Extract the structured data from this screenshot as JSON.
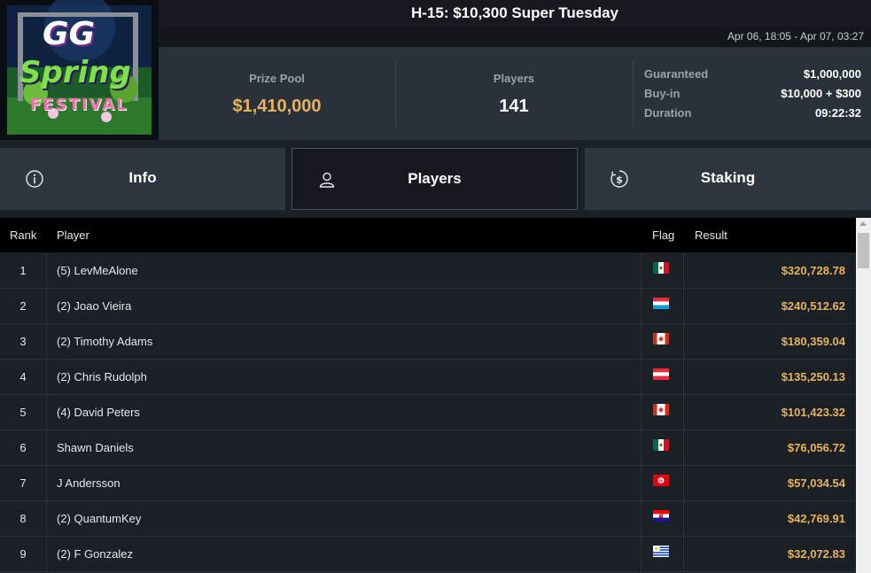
{
  "logo": {
    "line1": "GG",
    "line2": "Spring",
    "line3": "FESTIVAL"
  },
  "header": {
    "title": "H-15: $10,300 Super Tuesday",
    "dates": "Apr 06, 18:05 - Apr 07, 03:27"
  },
  "stats": {
    "prize_pool_label": "Prize Pool",
    "prize_pool_value": "$1,410,000",
    "players_label": "Players",
    "players_value": "141",
    "guaranteed_label": "Guaranteed",
    "guaranteed_value": "$1,000,000",
    "buyin_label": "Buy-in",
    "buyin_value": "$10,000 + $300",
    "duration_label": "Duration",
    "duration_value": "09:22:32"
  },
  "tabs": [
    {
      "label": "Info",
      "icon": "info-circle-icon"
    },
    {
      "label": "Players",
      "icon": "user-icon",
      "active": true
    },
    {
      "label": "Staking",
      "icon": "dollar-coin-icon"
    }
  ],
  "table": {
    "headers": {
      "rank": "Rank",
      "player": "Player",
      "flag": "Flag",
      "result": "Result"
    },
    "rows": [
      {
        "rank": "1",
        "player": "(5) LevMeAlone",
        "flag": "mexico",
        "result": "$320,728.78"
      },
      {
        "rank": "2",
        "player": "(2) Joao Vieira",
        "flag": "luxembourg",
        "result": "$240,512.62"
      },
      {
        "rank": "3",
        "player": "(2) Timothy Adams",
        "flag": "canada",
        "result": "$180,359.04"
      },
      {
        "rank": "4",
        "player": "(2) Chris Rudolph",
        "flag": "austria",
        "result": "$135,250.13"
      },
      {
        "rank": "5",
        "player": "(4) David Peters",
        "flag": "canada",
        "result": "$101,423.32"
      },
      {
        "rank": "6",
        "player": "Shawn Daniels",
        "flag": "mexico",
        "result": "$76,056.72"
      },
      {
        "rank": "7",
        "player": "J Andersson",
        "flag": "tunisia",
        "result": "$57,034.54"
      },
      {
        "rank": "8",
        "player": "(2) QuantumKey",
        "flag": "croatia",
        "result": "$42,769.91"
      },
      {
        "rank": "9",
        "player": "(2) F Gonzalez",
        "flag": "uruguay",
        "result": "$32,072.83"
      }
    ]
  },
  "colors": {
    "accent_gold": "#e8b35e",
    "panel": "#2a313b",
    "background": "#1b1f26"
  }
}
